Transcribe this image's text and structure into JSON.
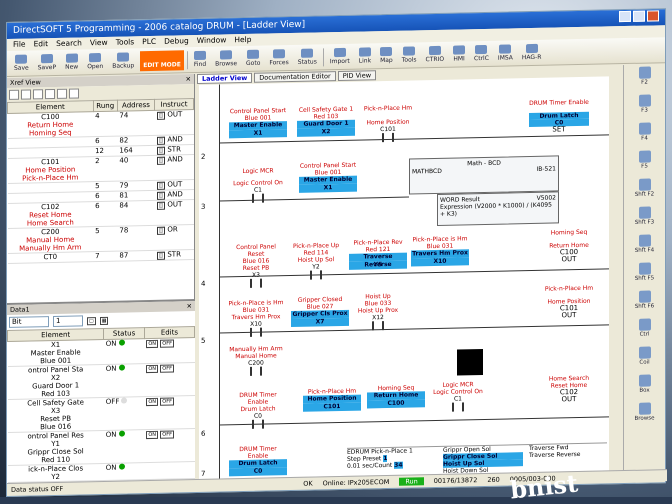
{
  "window": {
    "title": "DirectSOFT 5 Programming - 2006 catalog DRUM - [Ladder View]"
  },
  "menu": [
    "File",
    "Edit",
    "Search",
    "View",
    "Tools",
    "PLC",
    "Debug",
    "Window",
    "Help"
  ],
  "toolbar": [
    {
      "label": "Save",
      "icon": "save-icon"
    },
    {
      "label": "SaveP",
      "icon": "save-plc-icon"
    },
    {
      "label": "New",
      "icon": "new-icon"
    },
    {
      "label": "Open",
      "icon": "open-icon"
    },
    {
      "label": "Backup",
      "icon": "backup-icon"
    },
    {
      "label": "EDIT MODE",
      "icon": "edit-mode"
    },
    {
      "label": "Find",
      "icon": "find-icon"
    },
    {
      "label": "Browse",
      "icon": "browse-icon"
    },
    {
      "label": "Goto",
      "icon": "goto-icon"
    },
    {
      "label": "Forces",
      "icon": "forces-icon"
    },
    {
      "label": "Status",
      "icon": "status-icon"
    },
    {
      "label": "Import",
      "icon": "import-icon"
    },
    {
      "label": "Link",
      "icon": "link-icon"
    },
    {
      "label": "Map",
      "icon": "map-icon"
    },
    {
      "label": "Tools",
      "icon": "tools-icon"
    },
    {
      "label": "CTRIO",
      "icon": "ctrio-icon"
    },
    {
      "label": "HMI",
      "icon": "hmi-icon"
    },
    {
      "label": "CtrlC",
      "icon": "ctrlc-icon"
    },
    {
      "label": "IMSA",
      "icon": "imsa-icon"
    },
    {
      "label": "HAG-R",
      "icon": "hagr-icon"
    }
  ],
  "xref": {
    "title": "Xref View",
    "columns": [
      "Element",
      "Rung",
      "Address",
      "Instruct"
    ],
    "rows": [
      {
        "el": "C100",
        "nick1": "Return Home",
        "nick2": "Homing Seq",
        "lines": [
          [
            "4",
            "74",
            "OUT"
          ],
          [
            "6",
            "82",
            "AND"
          ],
          [
            "12",
            "164",
            "STR"
          ]
        ]
      },
      {
        "el": "C101",
        "nick1": "Home Position",
        "nick2": "Pick-n-Place Hm",
        "lines": [
          [
            "2",
            "40",
            "AND"
          ],
          [
            "5",
            "79",
            "OUT"
          ],
          [
            "6",
            "81",
            "AND"
          ]
        ]
      },
      {
        "el": "C102",
        "nick1": "Reset Home",
        "nick2": "Home Search",
        "lines": [
          [
            "6",
            "84",
            "OUT"
          ]
        ]
      },
      {
        "el": "C200",
        "nick1": "Manual Home",
        "nick2": "Manually Hm Arm",
        "lines": [
          [
            "5",
            "78",
            "OR"
          ]
        ]
      },
      {
        "el": "CT0",
        "nick1": "",
        "nick2": "",
        "lines": [
          [
            "7",
            "87",
            "STR"
          ]
        ]
      }
    ]
  },
  "status": {
    "title": "Data1",
    "type": "Bit",
    "count": "1",
    "columns": [
      "Element",
      "Status",
      "Edits"
    ],
    "rows": [
      {
        "el": "X1",
        "n1": "Master Enable",
        "n2": "Blue 001",
        "st": "ON"
      },
      {
        "el": "X2",
        "n1": "Guard Door 1",
        "n2": "Red 103",
        "st": "ON"
      },
      {
        "el": "X3",
        "n1": "Reset PB",
        "n2": "Blue 016",
        "st": "OFF"
      },
      {
        "el": "Y1",
        "n1": "Grippr Close Sol",
        "n2": "Red 110",
        "st": "ON"
      },
      {
        "el": "Y2",
        "n1": "",
        "n2": "",
        "st": "ON"
      }
    ],
    "left_labels": [
      "ontrol Panel Sta",
      "Cell Safety Gate",
      "ontrol Panel Res",
      "ick-n-Place Clos"
    ],
    "edit_on": "ON",
    "edit_off": "OFF"
  },
  "tabs": [
    "Ladder View",
    "Documentation Editor",
    "PID View"
  ],
  "rungs": {
    "r2": {
      "num": "2",
      "c1": {
        "top": "Control Panel Start",
        "mid": "Blue 001",
        "hl": "Master Enable",
        "addr": "X1"
      },
      "c2": {
        "top": "Cell Safety Gate 1",
        "mid": "Red 103",
        "hl": "Guard Door 1",
        "addr": "X2"
      },
      "c3": {
        "top": "Pick-n-Place Hm",
        "mid": "Home Position",
        "addr": "C101"
      },
      "coil": {
        "top": "DRUM Timer Enable",
        "hl": "Drum Latch",
        "addr": "C0",
        "op": "SET"
      }
    },
    "r3": {
      "num": "3",
      "c1": {
        "top": "Logic MCR",
        "mid": "Logic Control On",
        "addr": "C1"
      },
      "c2": {
        "top": "Control Panel Start",
        "mid": "Blue 001",
        "hl": "Master Enable",
        "addr": "X1"
      },
      "math": {
        "title": "Math - BCD",
        "name": "MATHBCD",
        "ib": "IB-521",
        "result": "WORD Result",
        "reg": "V5002",
        "expr": "Expression (V2000 * K1000) / (K4095 + K3)"
      }
    },
    "r4": {
      "num": "4",
      "c1": {
        "top": "Control Panel Reset",
        "mid": "Blue 016",
        "hl2": "Reset PB",
        "addr": "X3"
      },
      "c2": {
        "top": "Pick-n-Place Up",
        "mid": "Red 114",
        "hl2": "Hoist Up Sol",
        "addr": "Y2"
      },
      "c3": {
        "top": "Pick-n-Place Rev",
        "mid": "Red 121",
        "hl": "Traverse Reverse",
        "addr": "Y5"
      },
      "c4": {
        "top": "Pick-n-Place is Hm",
        "mid": "Blue 031",
        "hl": "Travers Hm Prox",
        "addr": "X10"
      },
      "coil": {
        "top": "Homing Seq",
        "mid": "Return Home",
        "addr": "C100",
        "op": "OUT"
      }
    },
    "r5": {
      "num": "5",
      "c1": {
        "top": "Pick-n-Place is Hm",
        "mid": "Blue 031",
        "hl2": "Travers Hm Prox",
        "addr": "X10"
      },
      "c2": {
        "top": "Gripper Closed",
        "mid": "Blue 027",
        "hl": "Gripper Cls Prox",
        "addr": "X7"
      },
      "c3": {
        "top": "Hoist Up",
        "mid": "Blue 033",
        "hl2": "Hoist Up Prox",
        "addr": "X12"
      },
      "c4": {
        "top": "Manually Hm Arm",
        "mid": "Manual Home",
        "addr": "C200"
      },
      "coil": {
        "top": "Pick-n-Place Hm",
        "mid": "Home Position",
        "addr": "C101",
        "op": "OUT"
      }
    },
    "r6": {
      "num": "6",
      "c1": {
        "top": "DRUM Timer Enable",
        "mid": "Drum Latch",
        "addr": "C0"
      },
      "c2": {
        "top": "Pick-n-Place Hm",
        "hl": "Home Position",
        "addr": "C101"
      },
      "c3": {
        "top": "Homing Seq",
        "hl": "Return Home",
        "addr": "C100"
      },
      "c4": {
        "top": "Logic MCR",
        "mid": "Logic Control On",
        "addr": "C1"
      },
      "coil": {
        "top": "Home Search",
        "mid": "Reset Home",
        "addr": "C102",
        "op": "OUT"
      }
    },
    "r7": {
      "num": "7",
      "c1": {
        "top": "DRUM Timer Enable",
        "hl": "Drum Latch",
        "addr": "C0"
      }
    }
  },
  "drum": {
    "name": "EDRUM",
    "desc": "Pick-n-Place 1",
    "preset_label": "Step Preset",
    "preset": "1",
    "count_label": "0.01 sec/Count",
    "count": "34",
    "outs": [
      "Grippr Open Sol",
      "Grippr Close Sol",
      "Hoist Up Sol",
      "Hoist Down Sol"
    ],
    "outs2": [
      "Traverse Fwd",
      "Traverse Reverse"
    ]
  },
  "right_keys": [
    "F2",
    "F3",
    "F4",
    "F5",
    "Shft F2",
    "Shft F3",
    "Shft F4",
    "Shft F5",
    "Shft F6",
    "Ctrl",
    "Coil",
    "Box",
    "Browse"
  ],
  "statusbar": {
    "left": "Data status OFF",
    "ok": "OK",
    "online": "Online: IPx205ECOM",
    "mode": "Run",
    "mem": "00176/13872",
    "pos": "260",
    "addr": "0005/003-000"
  },
  "watermark": "bnist"
}
